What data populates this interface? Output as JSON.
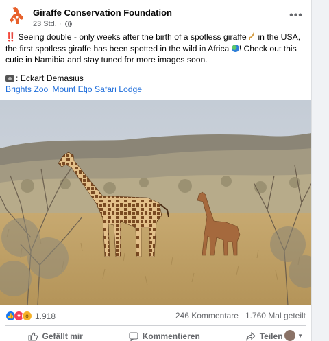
{
  "post": {
    "page_name": "Giraffe Conservation Foundation",
    "time": "23 Std.",
    "separator": "·",
    "more": "•••",
    "text_part1": "Seeing double - only weeks after the birth of a spotless giraffe",
    "text_part2": "in the USA, the first spotless giraffe has been spotted in the wild in Africa",
    "text_part3": "! Check out this cutie in Namibia and stay tuned for more images soon.",
    "credit": ": Eckart Demasius",
    "bangbang": "‼️",
    "tags": [
      "Brights Zoo",
      "Mount Etjo Safari Lodge"
    ]
  },
  "stats": {
    "reaction_count": "1.918",
    "comments": "246 Kommentare",
    "shares": "1.760 Mal geteilt"
  },
  "actions": {
    "like": "Gefällt mir",
    "comment": "Kommentieren",
    "share": "Teilen"
  },
  "colors": {
    "link": "#216fdb",
    "like_blue": "#1877f2",
    "love_red": "#f33e58",
    "wow_yellow": "#f7b125"
  },
  "icons": {
    "more": "more-horizontal-icon",
    "audience": "globe-icon",
    "like": "thumbs-up-icon",
    "comment": "comment-bubble-icon",
    "share": "share-arrow-icon"
  }
}
